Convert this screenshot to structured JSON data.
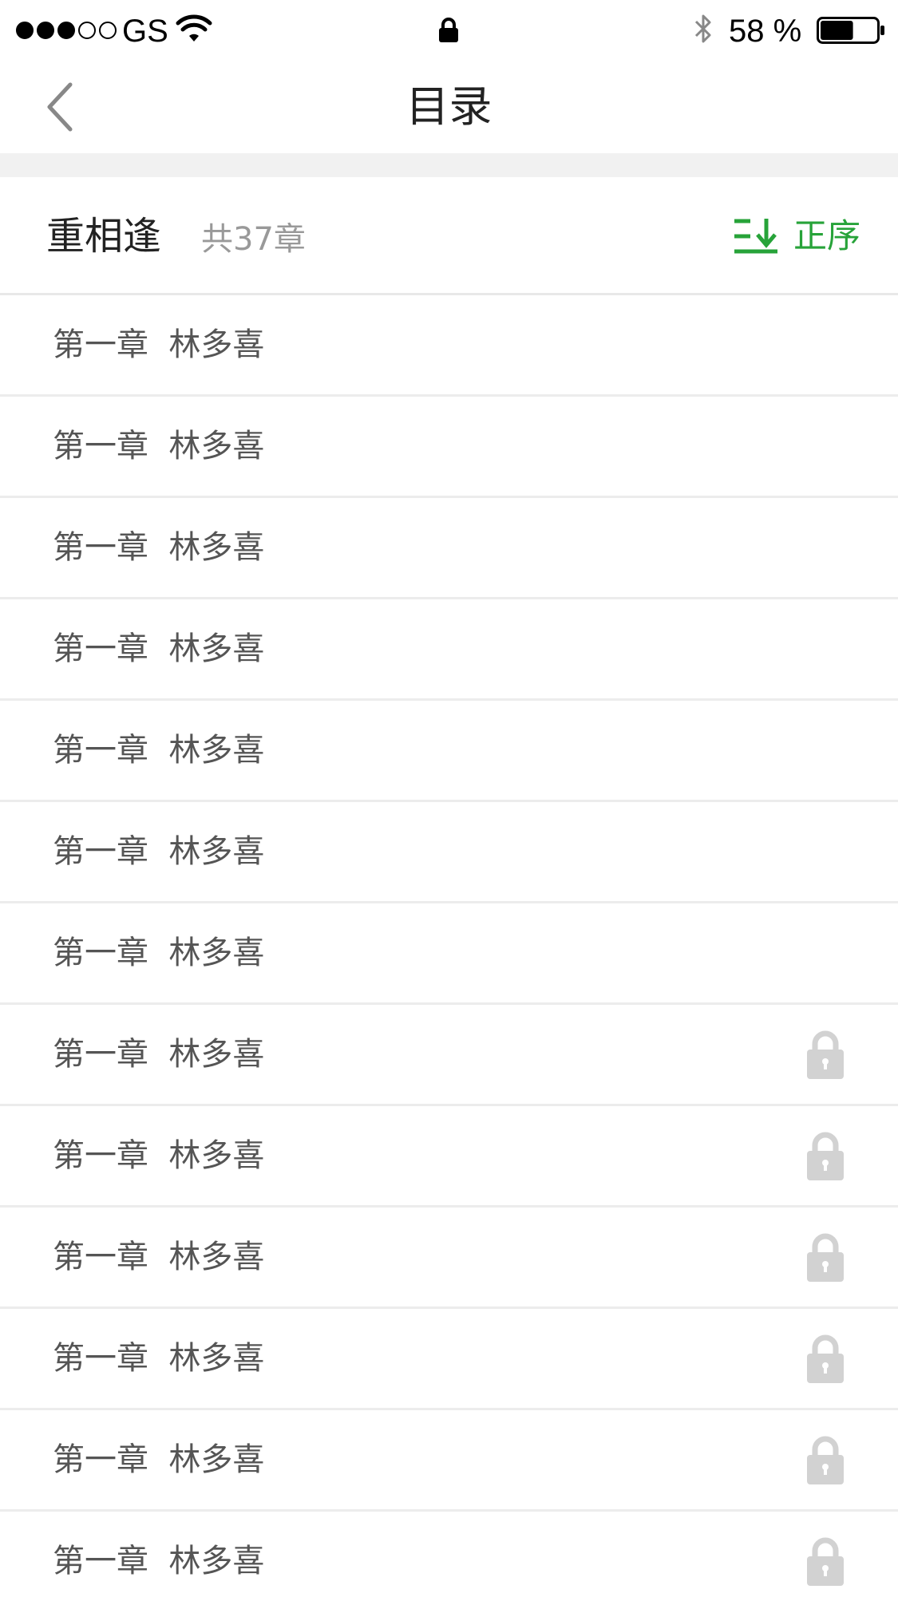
{
  "status_bar": {
    "carrier": "GS",
    "battery_percent": "58 %",
    "battery_level": 0.58,
    "signal_bars_filled": 3,
    "signal_bars_total": 5,
    "icons": [
      "signal-dots-icon",
      "wifi-icon",
      "lock-icon",
      "bluetooth-icon",
      "battery-icon"
    ]
  },
  "nav": {
    "title": "目录",
    "back_icon": "chevron-left-icon"
  },
  "book": {
    "title": "重相逢",
    "chapter_count": "共37章",
    "sort_label": "正序",
    "sort_icon": "sort-ascending-icon",
    "accent_color": "#27a339"
  },
  "chapters": [
    {
      "label": "第一章  林多喜",
      "locked": false
    },
    {
      "label": "第一章  林多喜",
      "locked": false
    },
    {
      "label": "第一章  林多喜",
      "locked": false
    },
    {
      "label": "第一章  林多喜",
      "locked": false
    },
    {
      "label": "第一章  林多喜",
      "locked": false
    },
    {
      "label": "第一章  林多喜",
      "locked": false
    },
    {
      "label": "第一章  林多喜",
      "locked": false
    },
    {
      "label": "第一章  林多喜",
      "locked": true
    },
    {
      "label": "第一章  林多喜",
      "locked": true
    },
    {
      "label": "第一章  林多喜",
      "locked": true
    },
    {
      "label": "第一章  林多喜",
      "locked": true
    },
    {
      "label": "第一章  林多喜",
      "locked": true
    },
    {
      "label": "第一章  林多喜",
      "locked": true
    }
  ]
}
